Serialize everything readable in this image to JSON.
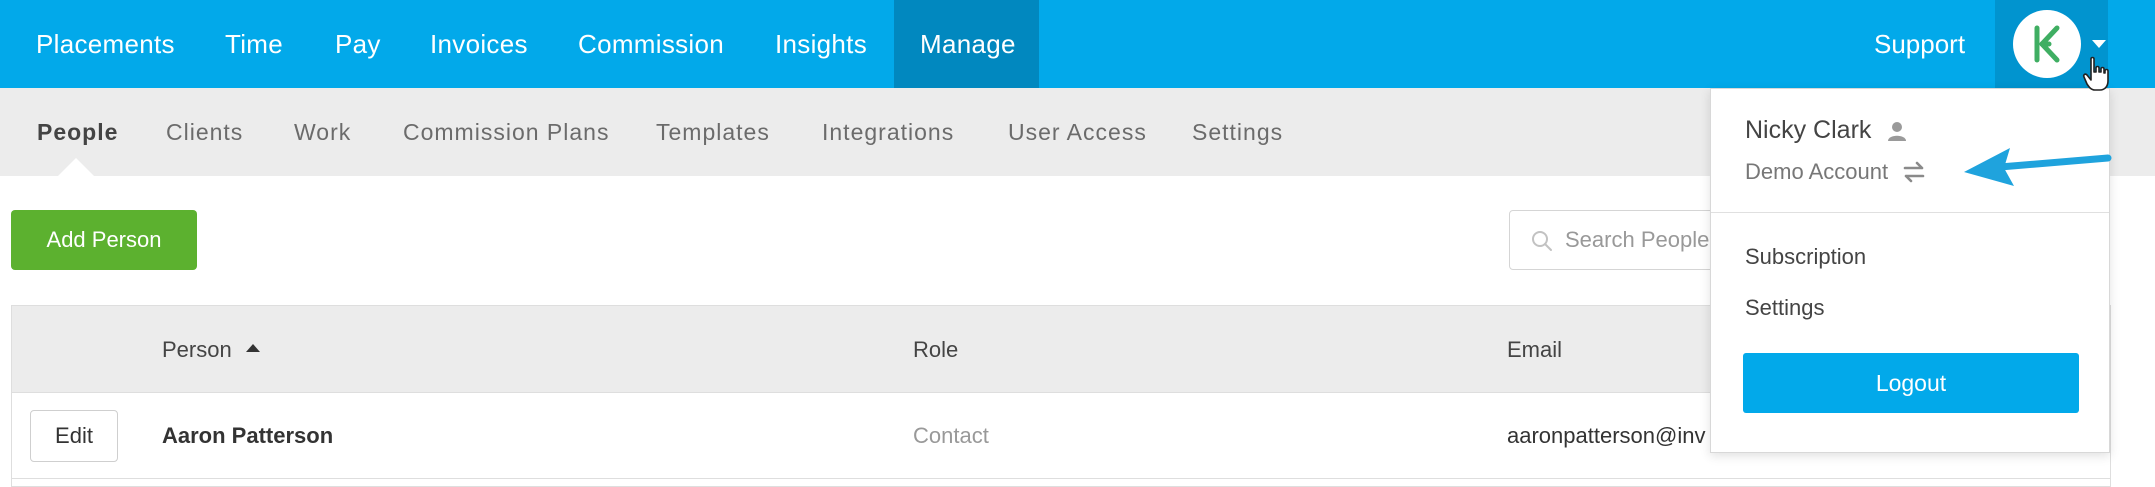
{
  "top_nav": {
    "items": [
      {
        "label": "Placements"
      },
      {
        "label": "Time"
      },
      {
        "label": "Pay"
      },
      {
        "label": "Invoices"
      },
      {
        "label": "Commission"
      },
      {
        "label": "Insights"
      },
      {
        "label": "Manage",
        "active": true
      }
    ],
    "support_label": "Support",
    "avatar_icon": "app-logo-icon",
    "colors": {
      "bar": "#02a9ea",
      "active": "#0188bf"
    }
  },
  "sub_nav": {
    "items": [
      {
        "label": "People",
        "active": true
      },
      {
        "label": "Clients"
      },
      {
        "label": "Work"
      },
      {
        "label": "Commission Plans"
      },
      {
        "label": "Templates"
      },
      {
        "label": "Integrations"
      },
      {
        "label": "User Access"
      },
      {
        "label": "Settings"
      }
    ]
  },
  "toolbar": {
    "add_person_label": "Add Person",
    "search_placeholder": "Search People"
  },
  "table": {
    "headers": {
      "person": "Person",
      "role": "Role",
      "email": "Email"
    },
    "sort": {
      "column": "Person",
      "direction": "ascending"
    },
    "rows": [
      {
        "action": "Edit",
        "person": "Aaron Patterson",
        "role": "Contact",
        "email": "aaronpatterson@inv"
      }
    ]
  },
  "user_menu": {
    "name": "Nicky Clark",
    "account": "Demo Account",
    "links": [
      "Subscription",
      "Settings"
    ],
    "logout_label": "Logout",
    "accent": "#02a9ea"
  }
}
